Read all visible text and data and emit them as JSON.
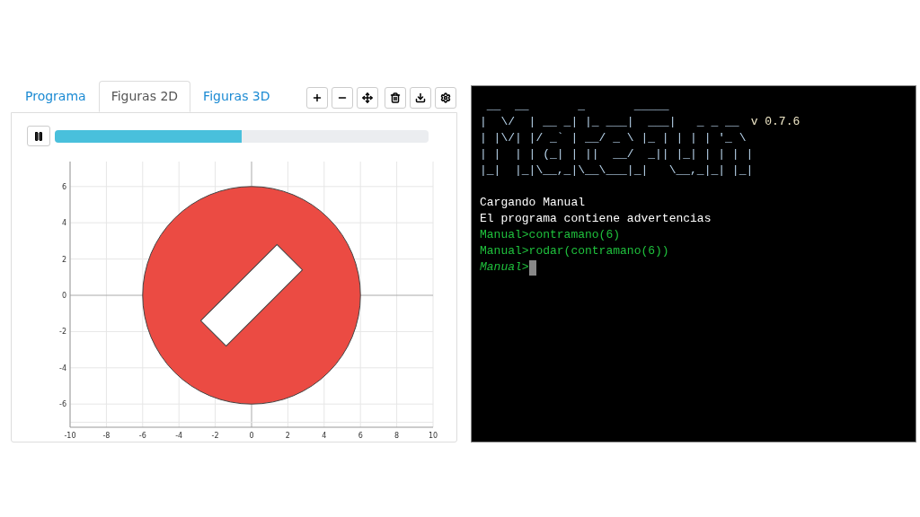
{
  "tabs": [
    {
      "label": "Programa",
      "selected": false
    },
    {
      "label": "Figuras 2D",
      "selected": true
    },
    {
      "label": "Figuras 3D",
      "selected": false
    }
  ],
  "animation": {
    "playing": true,
    "level": 0.5
  },
  "plot": {
    "xticks": [
      "-10",
      "-8",
      "-6",
      "-4",
      "-2",
      "0",
      "2",
      "4",
      "6",
      "8",
      "10"
    ],
    "yticks": [
      "6",
      "4",
      "2",
      "0",
      "-2",
      "-4",
      "-6"
    ]
  },
  "terminal": {
    "banner": [
      " __  __       _       _____",
      "|  \\/  | __ _| |_ ___|  ___|   _ _ __",
      "| |\\/| |/ _` | __/ _ \\ |_ | | | | '_ \\",
      "| |  | | (_| | ||  __/  _|| |_| | | | |",
      "|_|  |_|\\__,_|\\__\\___|_|   \\__,_|_| |_|"
    ],
    "version": "v 0.7.6",
    "lines": [
      {
        "kind": "output",
        "text": "Cargando Manual"
      },
      {
        "kind": "output",
        "text": "El programa contiene advertencias"
      },
      {
        "kind": "command",
        "text": "Manual>contramano(6)"
      },
      {
        "kind": "command",
        "text": "Manual>rodar(contramano(6))"
      },
      {
        "kind": "prompt",
        "text": "Manual>"
      }
    ]
  }
}
